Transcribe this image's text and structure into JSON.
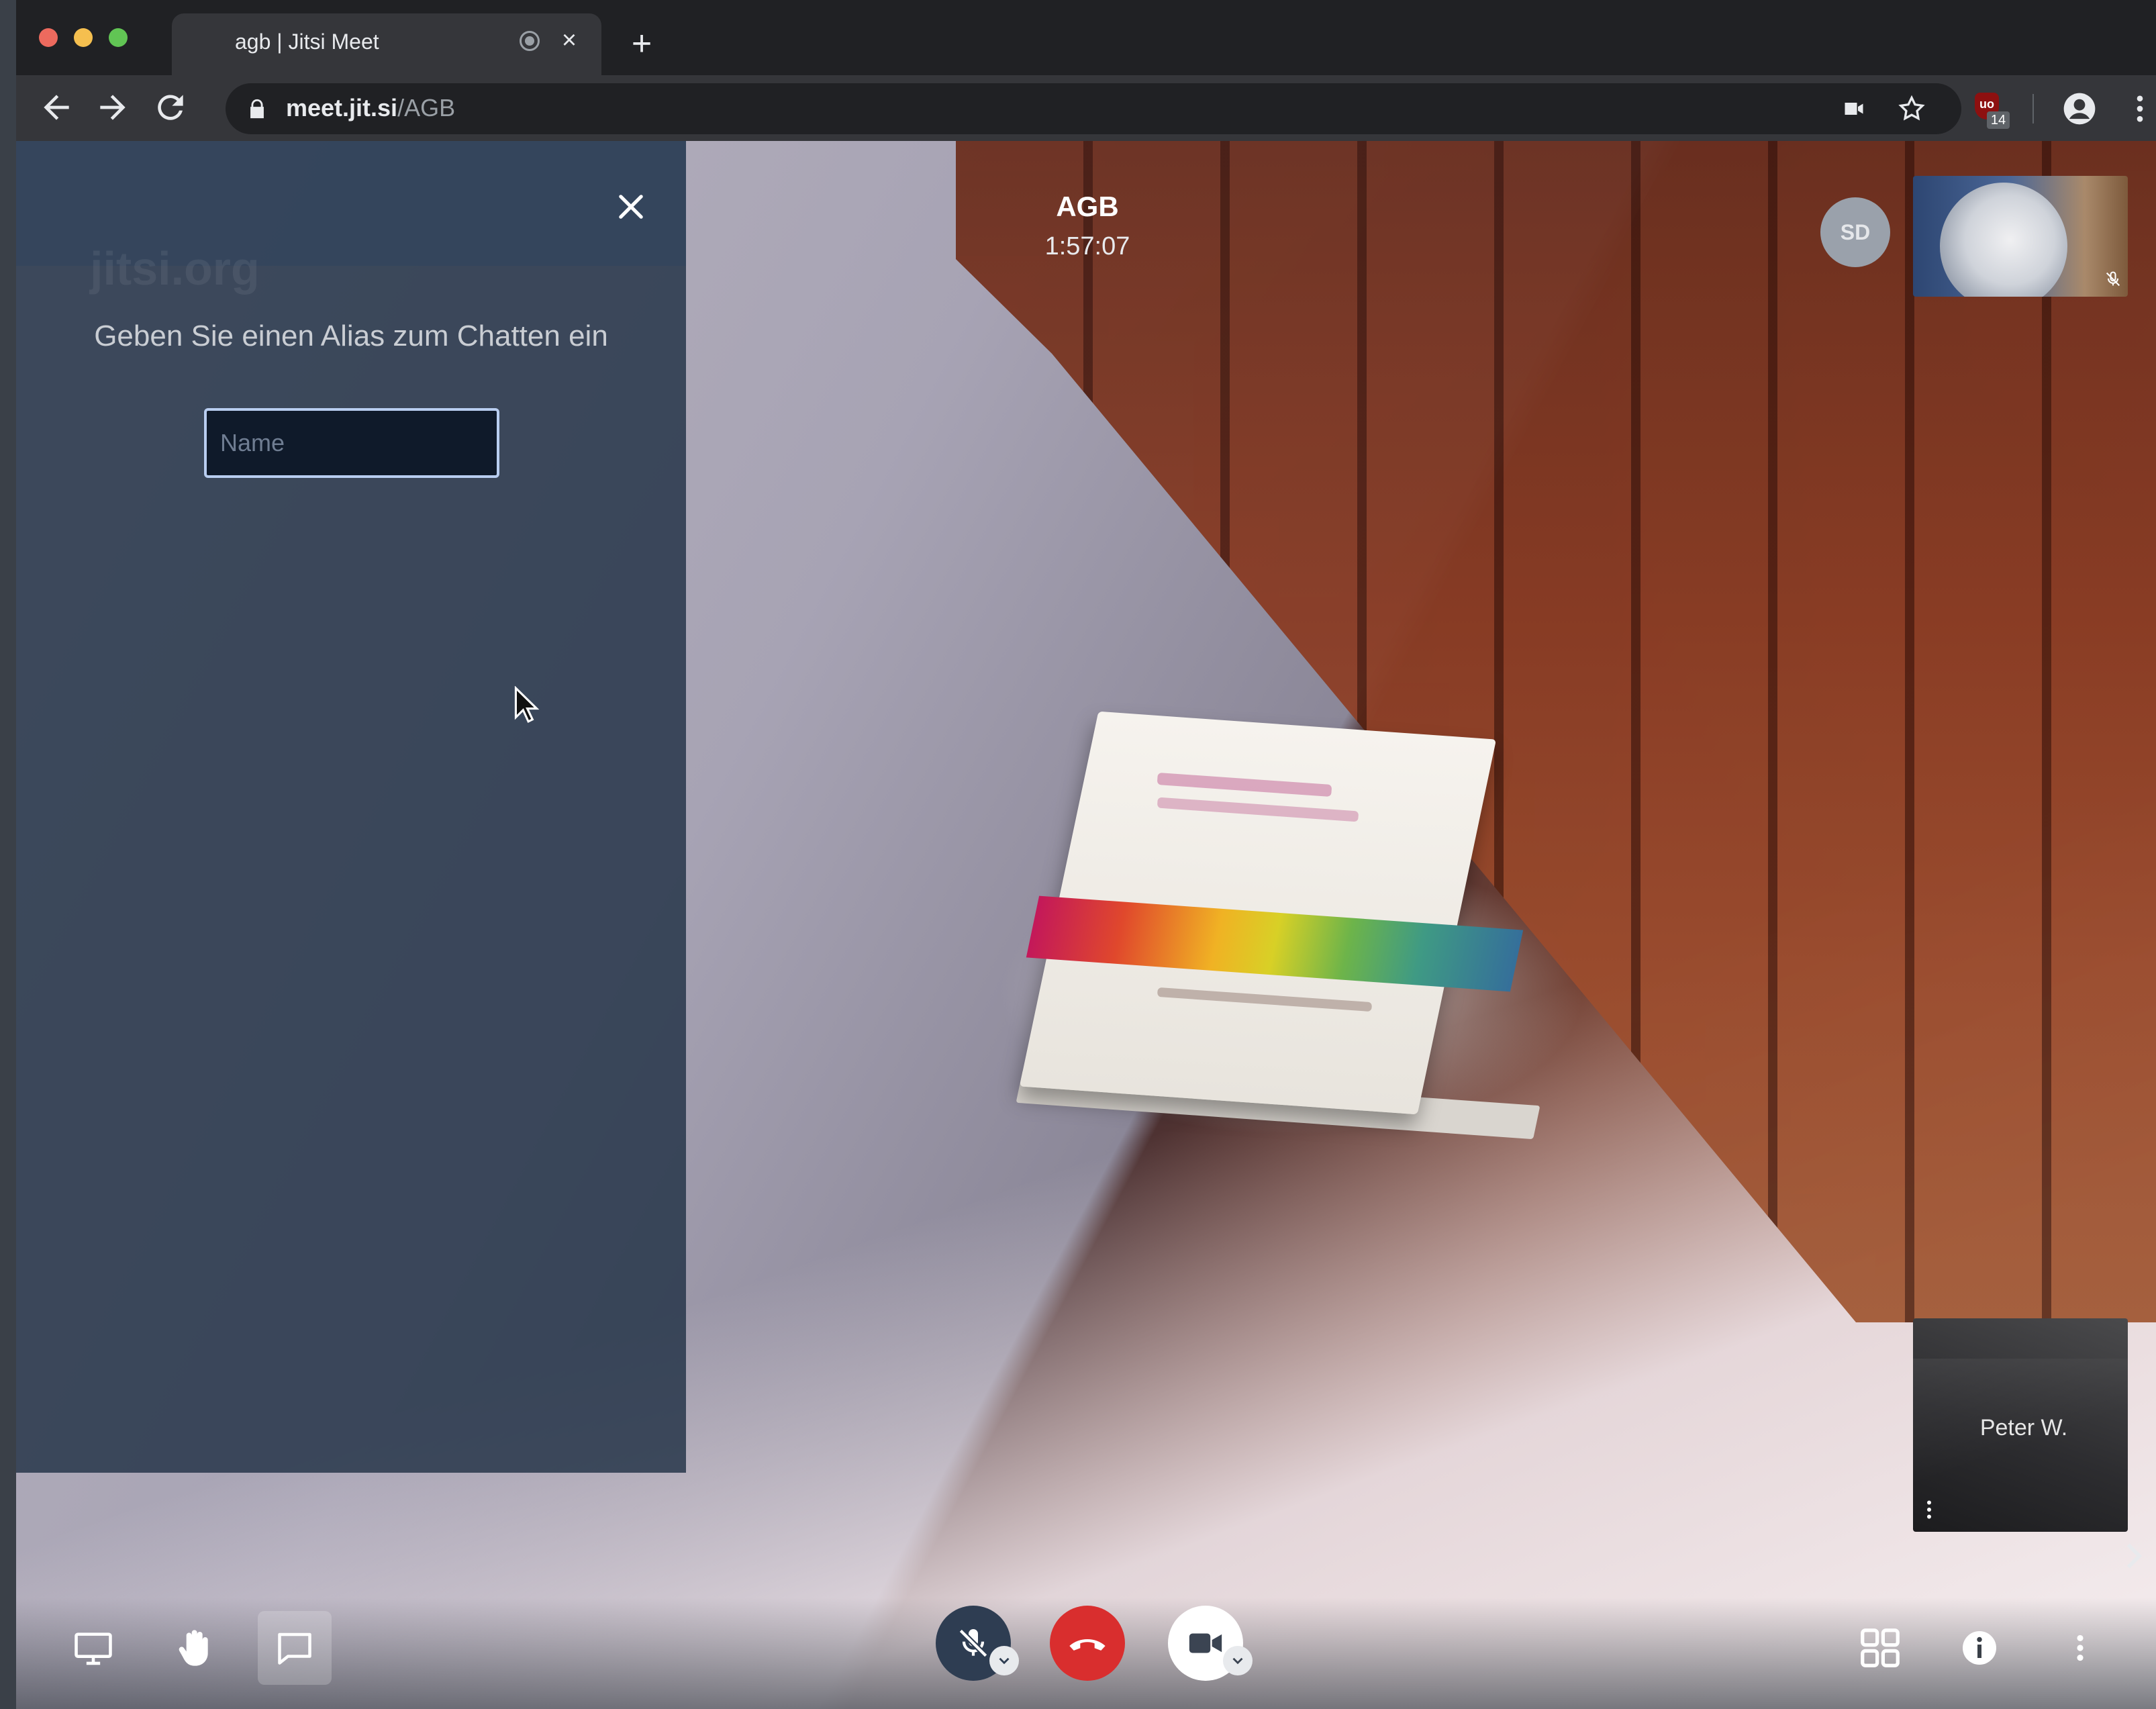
{
  "browser": {
    "tab_title": "agb | Jitsi Meet",
    "url_host": "meet.jit.si",
    "url_path": "/AGB",
    "extension_badge": "14",
    "extension_label": "uo"
  },
  "chat": {
    "watermark": "jitsi.org",
    "prompt": "Geben Sie einen Alias zum Chatten ein",
    "name_placeholder": "Name",
    "name_value": ""
  },
  "conference": {
    "room_name": "AGB",
    "timer": "1:57:07",
    "avatar_initials": "SD",
    "remote_participant_name": "Peter W."
  },
  "toolbar": {
    "left": [
      "screen-share",
      "raise-hand",
      "chat"
    ],
    "center": [
      "microphone-muted",
      "hangup",
      "camera"
    ],
    "right": [
      "tile-view",
      "info",
      "more-options"
    ]
  },
  "colors": {
    "hangup": "#d92e2e",
    "chat_panel": "#28374b",
    "input_border": "#b8cdf0"
  }
}
